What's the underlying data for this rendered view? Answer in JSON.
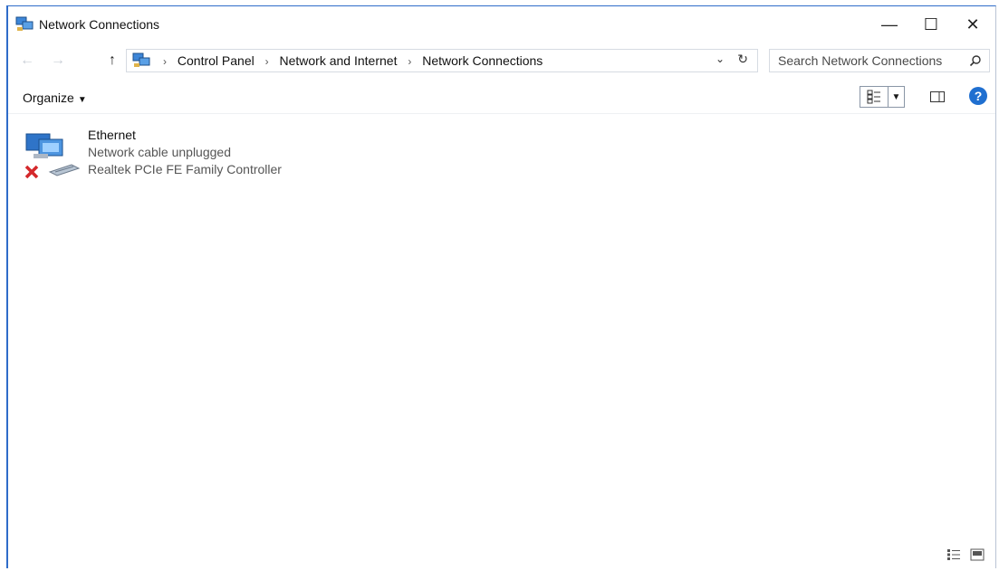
{
  "window": {
    "title": "Network Connections",
    "controls": {
      "minimize": "—",
      "maximize": "☐",
      "close": "✕"
    }
  },
  "address_bar": {
    "breadcrumbs": [
      "Control Panel",
      "Network and Internet",
      "Network Connections"
    ],
    "search_placeholder": "Search Network Connections"
  },
  "command_bar": {
    "organize_label": "Organize"
  },
  "connections": [
    {
      "name": "Ethernet",
      "status": "Network cable unplugged",
      "device": "Realtek PCIe FE Family Controller",
      "icon": "network-adapter-disconnected-icon"
    }
  ],
  "colors": {
    "accent": "#2f6cc9",
    "help": "#1f6fd0",
    "error_x": "#d4282b"
  }
}
